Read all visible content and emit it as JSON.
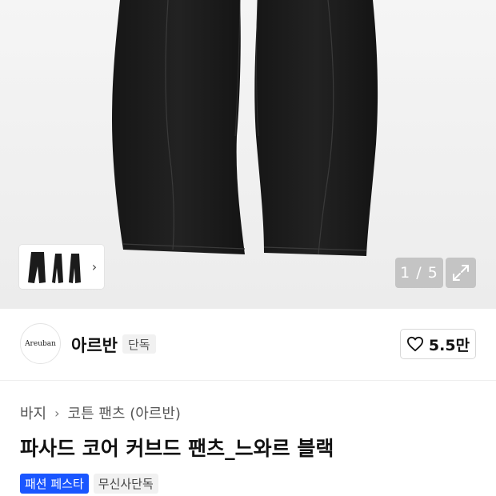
{
  "gallery": {
    "counter": "1 / 5",
    "thumbnail_chevron": "›",
    "expand_icon": "expand-arrows-icon"
  },
  "brand": {
    "logo_text": "Areuban",
    "name": "아르반",
    "badge": "단독"
  },
  "like": {
    "count": "5.5만",
    "icon": "heart-outline-icon"
  },
  "breadcrumb": {
    "level1": "바지",
    "separator": "›",
    "level2": "코튼 팬츠 (아르반)"
  },
  "product": {
    "title": "파사드 코어 커브드 팬츠_느와르 블랙"
  },
  "tags": {
    "primary": "패션 페스타",
    "secondary": "무신사단독"
  },
  "colors": {
    "accent_blue": "#1a56ff",
    "pants_black": "#1a1a1a",
    "hero_bg": "#efefef"
  }
}
